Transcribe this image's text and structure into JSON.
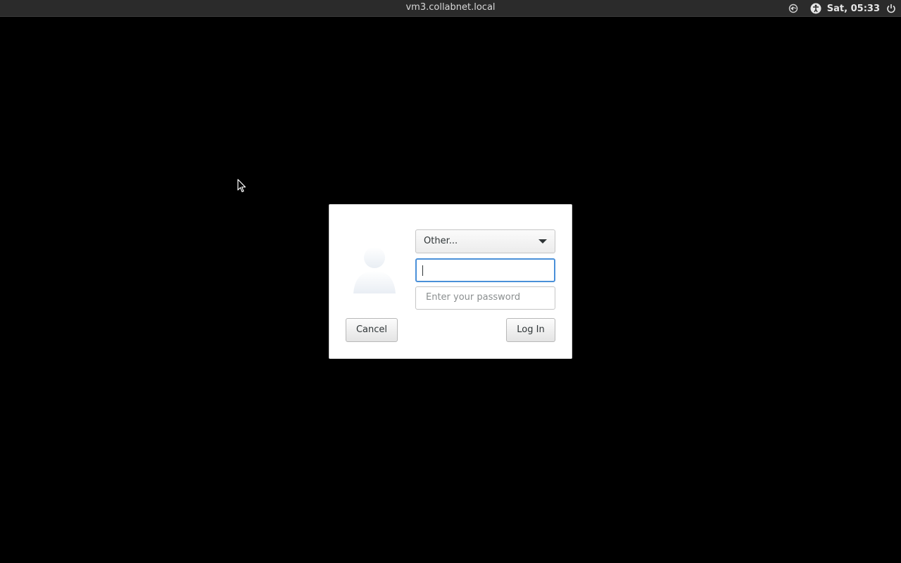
{
  "topbar": {
    "hostname": "vm3.collabnet.local",
    "clock": "Sat, 05:33",
    "icons": [
      "network-icon",
      "accessibility-icon",
      "power-icon"
    ]
  },
  "dialog": {
    "user_select": {
      "selected": "Other..."
    },
    "username": {
      "value": "",
      "placeholder": ""
    },
    "password": {
      "value": "",
      "placeholder": "Enter your password"
    },
    "cancel_label": "Cancel",
    "login_label": "Log In"
  },
  "colors": {
    "topbar_bg": "#2b2b2b",
    "focus_accent": "#4a90d9",
    "background": "#000000"
  }
}
